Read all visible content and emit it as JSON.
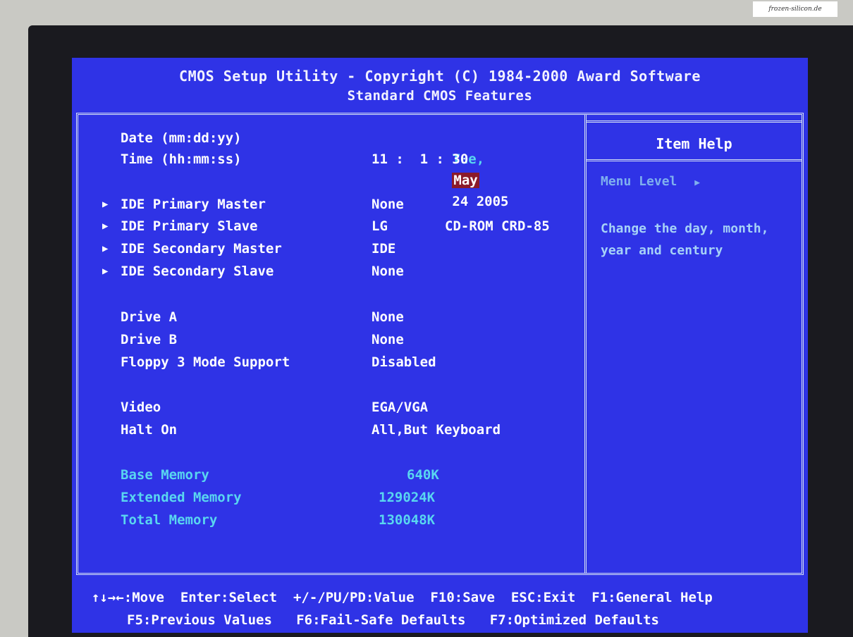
{
  "header": {
    "title": "CMOS Setup Utility - Copyright (C) 1984-2000 Award Software",
    "subtitle": "Standard CMOS Features"
  },
  "watermark": "frozen-silicon.de",
  "settings": {
    "date": {
      "label": "Date (mm:dd:yy)",
      "weekday": "Tue,",
      "month": "May",
      "day_year": "24 2005"
    },
    "time": {
      "label": "Time (hh:mm:ss)",
      "value": "11 :  1 : 30"
    },
    "ide_primary_master": {
      "label": "IDE Primary Master",
      "value": "None"
    },
    "ide_primary_slave": {
      "label": "IDE Primary Slave",
      "value": "LG",
      "value2": "CD-ROM CRD-85"
    },
    "ide_secondary_master": {
      "label": "IDE Secondary Master",
      "value": "IDE"
    },
    "ide_secondary_slave": {
      "label": "IDE Secondary Slave",
      "value": "None"
    },
    "drive_a": {
      "label": "Drive A",
      "value": "None"
    },
    "drive_b": {
      "label": "Drive B",
      "value": "None"
    },
    "floppy3": {
      "label": "Floppy 3 Mode Support",
      "value": "Disabled"
    },
    "video": {
      "label": "Video",
      "value": "EGA/VGA"
    },
    "halt_on": {
      "label": "Halt On",
      "value": "All,But Keyboard"
    },
    "base_memory": {
      "label": "Base Memory",
      "value": "640K"
    },
    "extended_memory": {
      "label": "Extended Memory",
      "value": "129024K"
    },
    "total_memory": {
      "label": "Total Memory",
      "value": "130048K"
    }
  },
  "help": {
    "title": "Item Help",
    "menu_level": "Menu Level",
    "text": "Change the day, month, year and century"
  },
  "footer": {
    "line1": "↑↓→←:Move  Enter:Select  +/-/PU/PD:Value  F10:Save  ESC:Exit  F1:General Help",
    "line2": "F5:Previous Values   F6:Fail-Safe Defaults   F7:Optimized Defaults"
  },
  "colors": {
    "screen": "#2f33e6",
    "highlight": "#8b1a2a",
    "dim_text": "#59d6f0"
  }
}
